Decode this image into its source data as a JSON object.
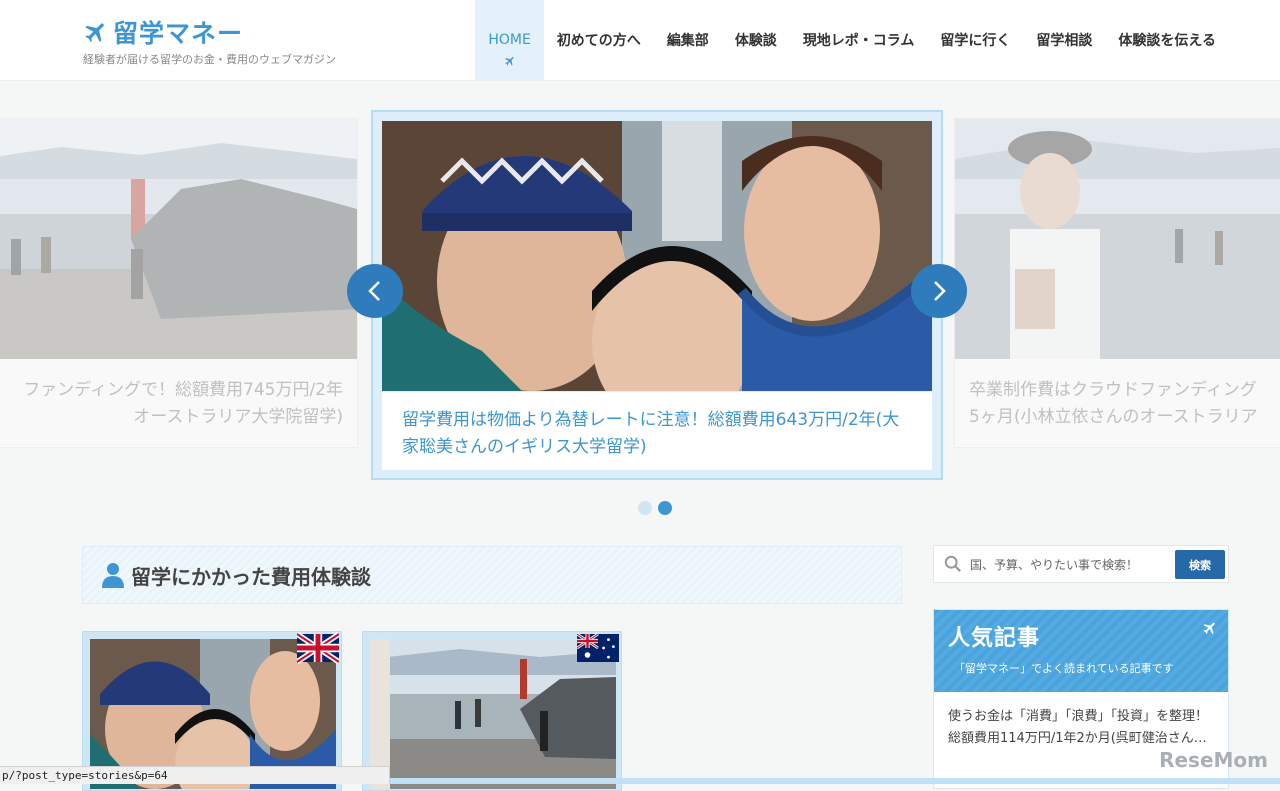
{
  "header": {
    "site_title": "留学マネー",
    "tagline": "経験者が届ける留学のお金・費用のウェブマガジン",
    "nav": [
      "HOME",
      "初めての方へ",
      "編集部",
      "体験談",
      "現地レポ・コラム",
      "留学に行く",
      "留学相談",
      "体験談を伝える"
    ]
  },
  "slider": {
    "left_caption": [
      "ファンディングで！総額費用745万円/2年",
      "オーストラリア大学院留学)"
    ],
    "center_caption": "留学費用は物価より為替レートに注意！総額費用643万円/2年(大家聡美さんのイギリス大学留学)",
    "right_caption": [
      "卒業制作費はクラウドファンディング",
      "5ヶ月(小林立依さんのオーストラリア"
    ]
  },
  "section": {
    "title": "留学にかかった費用体験談"
  },
  "cards": [
    {
      "flag": "uk-flag"
    },
    {
      "flag": "australia-flag"
    }
  ],
  "search": {
    "placeholder": "国、予算、やりたい事で検索！",
    "button": "検索"
  },
  "popular": {
    "title": "人気記事",
    "subtitle": "「留学マネー」でよく読まれている記事です",
    "first_article": "使うお金は「消費」「浪費」「投資」を整理！総額費用114万円/1年2か月(呉町健治さん…"
  },
  "statusbar": {
    "url": "p/?post_type=stories&p=64"
  },
  "watermark": "ReseMom"
}
